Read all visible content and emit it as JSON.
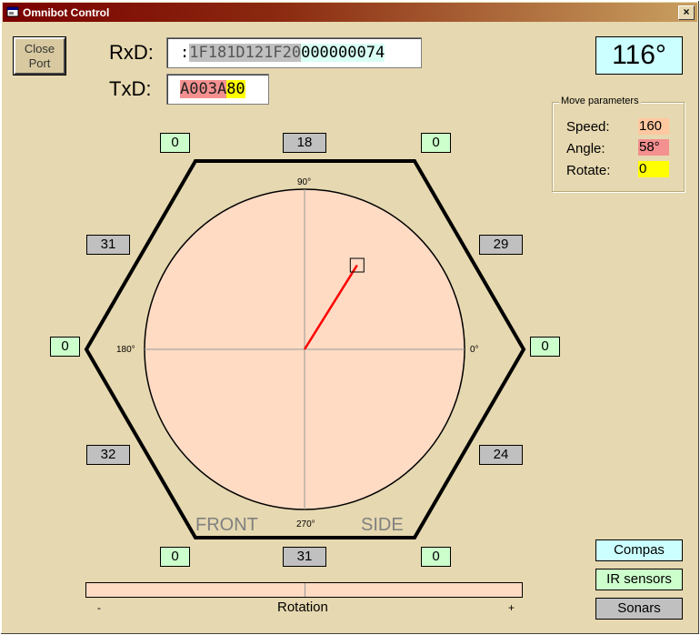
{
  "window": {
    "title": "Omnibot Control",
    "close_glyph": "×"
  },
  "close_port": {
    "line1": "Close",
    "line2": "Port"
  },
  "rxd": {
    "label": "RxD:",
    "prefix": ":",
    "gray_part": "1F181D121F20",
    "cyan_part": "000000074"
  },
  "txd": {
    "label": "TxD:",
    "red_part": "A003A",
    "yellow_part": "80"
  },
  "heading": "116°",
  "move_parameters": {
    "title": "Move parameters",
    "speed": {
      "label": "Speed:",
      "value": "160",
      "color": "#ffc8a0"
    },
    "angle": {
      "label": "Angle:",
      "value": "58°",
      "color": "#f49090"
    },
    "rotate": {
      "label": "Rotate:",
      "value": "0",
      "color": "#ffff00"
    }
  },
  "sensors": {
    "top_left": "0",
    "top_center": "18",
    "top_right": "0",
    "upper_left": "31",
    "upper_right": "29",
    "left": "0",
    "right": "0",
    "lower_left": "32",
    "lower_right": "24",
    "bottom_left": "0",
    "bottom_center": "31",
    "bottom_right": "0"
  },
  "dial": {
    "angle_labels": {
      "a90": "90°",
      "a180": "180°",
      "a0": "0°",
      "a270": "270°"
    },
    "front_label": "FRONT",
    "side_label": "SIDE",
    "direction_angle_deg": 58,
    "direction_magnitude": 0.62
  },
  "rotation": {
    "label": "Rotation",
    "minus": "-",
    "plus": "+",
    "value": 0
  },
  "side_buttons": {
    "compas": "Compas",
    "ir_sensors": "IR sensors",
    "sonars": "Sonars"
  },
  "colors": {
    "dial_fill": "#ffdbc4",
    "vector": "#ff0000",
    "sensor_ir": "#ccffcc",
    "sensor_sonar": "#c0c0c0",
    "heading_bg": "#ccffff"
  }
}
